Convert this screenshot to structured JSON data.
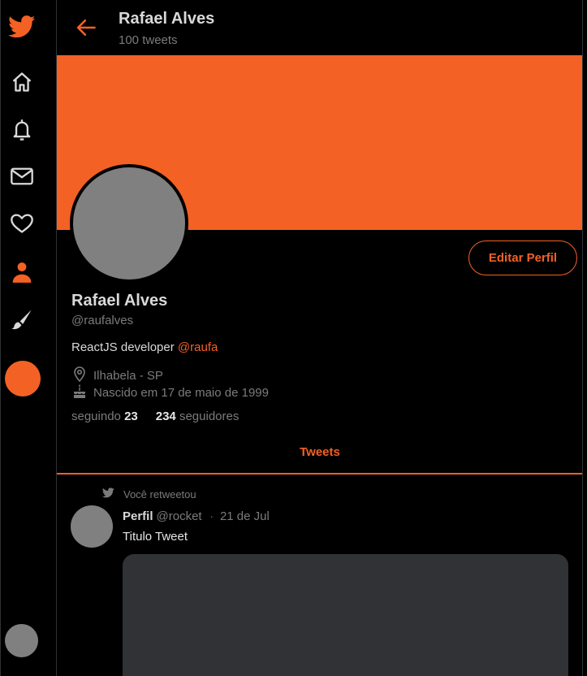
{
  "colors": {
    "accent": "#f46124",
    "background": "#000000",
    "muted": "#7b7b7b",
    "text": "#d9d9d9",
    "avatar": "#808080",
    "media": "#303236"
  },
  "sidebar": {
    "items": [
      {
        "icon": "twitter-bird-icon"
      },
      {
        "icon": "home-icon"
      },
      {
        "icon": "bell-icon"
      },
      {
        "icon": "mail-icon"
      },
      {
        "icon": "heart-icon"
      },
      {
        "icon": "person-icon",
        "active": true
      },
      {
        "icon": "brush-icon"
      }
    ]
  },
  "header": {
    "title": "Rafael Alves",
    "tweet_count": "100 tweets"
  },
  "profile": {
    "name": "Rafael Alves",
    "handle": "@raufalves",
    "bio_text": "ReactJS developer ",
    "bio_mention": "@raufa",
    "location": "Ilhabela - SP",
    "birth": "Nascido em 17 de maio de 1999",
    "following_label": "seguindo",
    "following_count": "23",
    "followers_count": "234",
    "followers_label": "seguidores",
    "edit_button": "Editar Perfil"
  },
  "tabs": {
    "tweets": "Tweets"
  },
  "tweet": {
    "retweet_label": "Você retweetou",
    "author": "Perfil",
    "handle": "@rocket",
    "separator": "·",
    "date": "21 de Jul",
    "text": "Titulo Tweet"
  }
}
